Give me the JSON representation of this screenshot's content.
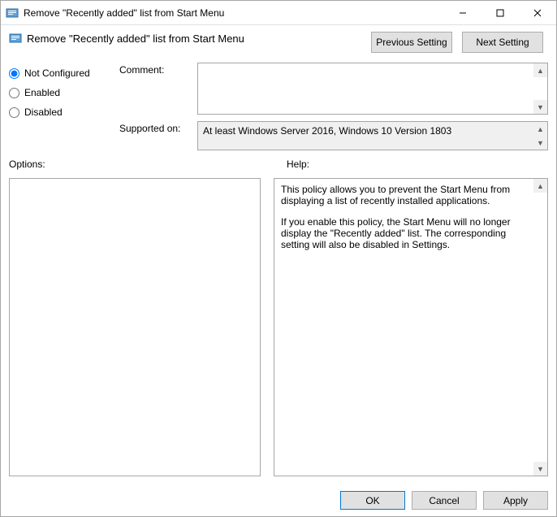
{
  "titlebar": {
    "title": "Remove \"Recently added\" list from Start Menu"
  },
  "header": {
    "title": "Remove \"Recently added\" list from Start Menu",
    "prev": "Previous Setting",
    "next": "Next Setting"
  },
  "state": {
    "not_configured": "Not Configured",
    "enabled": "Enabled",
    "disabled": "Disabled"
  },
  "labels": {
    "comment": "Comment:",
    "supported": "Supported on:",
    "options": "Options:",
    "help": "Help:"
  },
  "supported_on": "At least Windows Server 2016, Windows 10 Version 1803",
  "help": {
    "p1": "This policy allows you to prevent the Start Menu from displaying a list of recently installed applications.",
    "p2": "If you enable this policy, the Start Menu will no longer display the \"Recently added\" list.  The corresponding setting will also be disabled in Settings."
  },
  "footer": {
    "ok": "OK",
    "cancel": "Cancel",
    "apply": "Apply"
  }
}
